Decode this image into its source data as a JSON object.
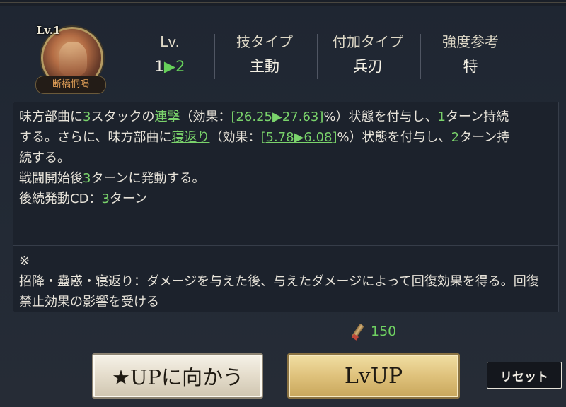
{
  "skill": {
    "level_badge": "Lv.1",
    "name": "断橋恫喝"
  },
  "stats": [
    {
      "label": "Lv.",
      "from": "1",
      "arrow": "▶",
      "to": "2"
    },
    {
      "label": "技タイプ",
      "value": "主動"
    },
    {
      "label": "付加タイプ",
      "value": "兵刃"
    },
    {
      "label": "強度参考",
      "value": "特"
    }
  ],
  "description": {
    "l1": [
      "味方部曲に",
      "3",
      "スタックの",
      "連撃",
      "（効果：",
      "[26.25▶27.63]",
      "%）状態を付与し、",
      "1",
      "ターン持続"
    ],
    "l2": [
      "する。さらに、味方部曲に",
      "寝返り",
      "（効果：",
      "[5.78▶6.08]",
      "%）状態を付与し、",
      "2",
      "ターン持"
    ],
    "l3": "続する。",
    "l4": [
      "戦闘開始後",
      "3",
      "ターンに発動する。"
    ],
    "l5": [
      "後続発動CD：",
      "3",
      "ターン"
    ]
  },
  "note": {
    "mark": "※",
    "l1": "招降・蠱惑・寝返り：ダメージを与えた後、与えたダメージによって回復効果を得る。回復",
    "l2": "禁止効果の影響を受ける"
  },
  "cost": {
    "icon": "scroll-icon",
    "value": "150"
  },
  "buttons": {
    "star_up": "★UPに向かう",
    "lv_up": "LvUP",
    "reset": "リセット"
  },
  "colors": {
    "highlight_green": "#7ad36b",
    "lvup_gold": "#dfc27c"
  }
}
